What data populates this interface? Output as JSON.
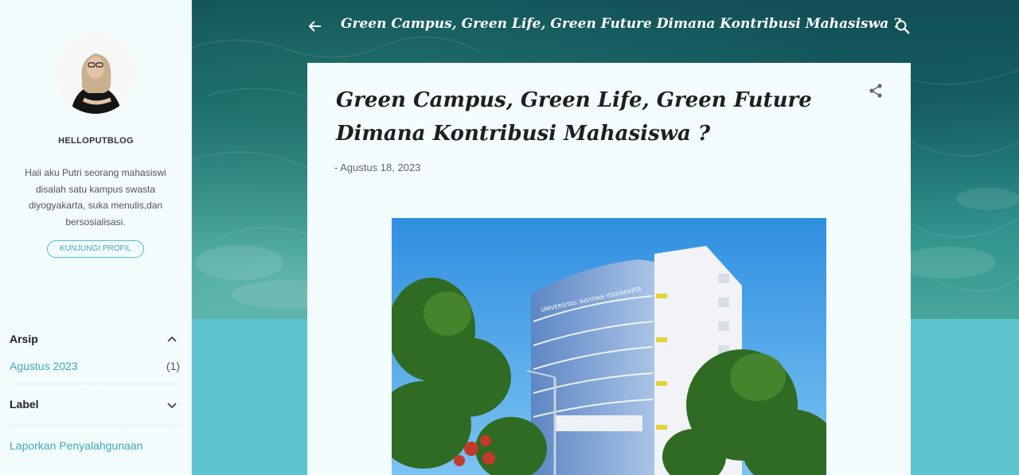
{
  "sidebar": {
    "blog_name": "HELLOPUTBLOG",
    "description": "Haii aku Putri seorang mahasiswi disalah satu kampus swasta diyogyakarta, suka menulis,dan bersosialisasi.",
    "profile_button": "KUNJUNGI PROFIL",
    "archive": {
      "title": "Arsip",
      "items": [
        {
          "label": "Agustus 2023",
          "count": "(1)"
        }
      ]
    },
    "labels": {
      "title": "Label"
    },
    "report_link": "Laporkan Penyalahgunaan"
  },
  "header": {
    "title": "Green Campus, Green Life, Green Future Dimana Kontribusi Mahasiswa ?"
  },
  "post": {
    "title": "Green Campus, Green Life, Green Future Dimana Kontribusi Mahasiswa ?",
    "date": "- Agustus 18, 2023",
    "image_sign": "UNIVERSITAS 'AISYIYAH YOGYAKARTA"
  },
  "icons": {
    "back": "arrow-left-icon",
    "search": "search-icon",
    "share": "share-icon",
    "chevron_up": "chevron-up-icon",
    "chevron_down": "chevron-down-icon"
  },
  "colors": {
    "accent": "#3fa8ba",
    "page_bg": "#5ec5d0",
    "sidebar_bg": "#f2fcfd",
    "card_bg": "#f4fdfd"
  }
}
